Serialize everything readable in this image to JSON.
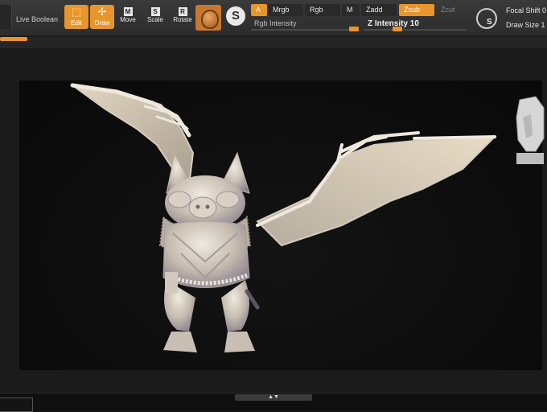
{
  "toolbar": {
    "live_boolean": "Live Boolean",
    "tools": [
      {
        "label": "Edit",
        "active": true
      },
      {
        "label": "Draw",
        "active": true
      },
      {
        "label": "Move",
        "key": "M"
      },
      {
        "label": "Scale",
        "key": "S"
      },
      {
        "label": "Rotate",
        "key": "R"
      }
    ],
    "chips": {
      "a": "A",
      "mrgb": "Mrgb",
      "rgb": "Rgb",
      "m": "M",
      "zadd": "Zadd",
      "zsub": "Zsub",
      "zcut": "Zcut"
    },
    "rgb_intensity": "Rgb Intensity",
    "z_intensity": "Z Intensity 10",
    "focal_shift": "Focal Shift 0",
    "draw_size": "Draw Size 1",
    "stroke_icon": "S",
    "s_icon": "S"
  },
  "colors": {
    "accent": "#e8952b",
    "ui_bg": "#2c2c2c",
    "canvas_bg": "#0c0c0c",
    "model": "#c9c0b4"
  },
  "icons": [
    "edit-icon",
    "draw-icon",
    "move-icon",
    "scale-icon",
    "rotate-icon",
    "material-icon",
    "stroke-icon",
    "lightbox-icon",
    "navigation-head-icon"
  ]
}
